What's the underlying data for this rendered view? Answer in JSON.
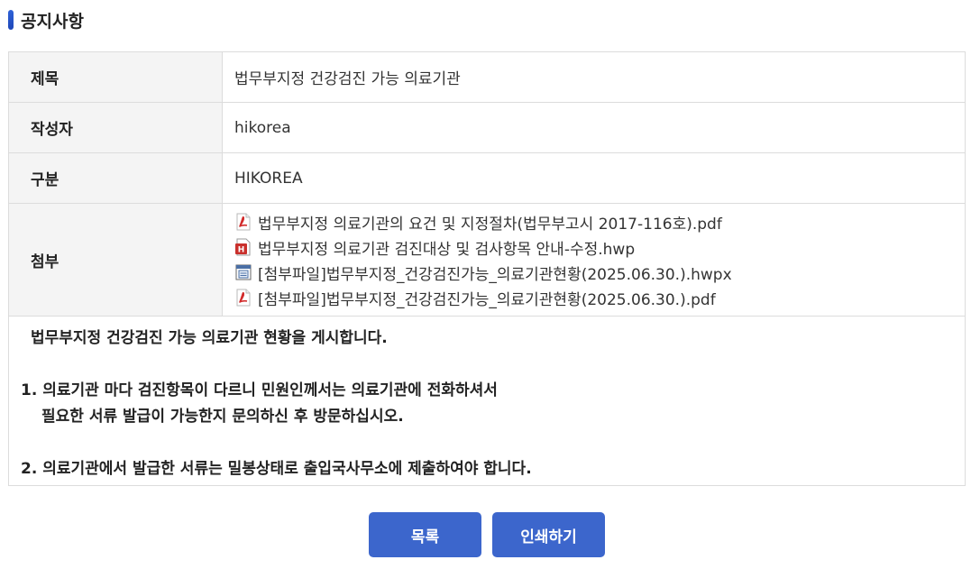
{
  "header": {
    "title": "공지사항"
  },
  "details": {
    "title_label": "제목",
    "title_value": "법무부지정 건강검진 가능 의료기관",
    "author_label": "작성자",
    "author_value": "hikorea",
    "category_label": "구분",
    "category_value": "HIKOREA",
    "attachments_label": "첨부"
  },
  "attachments": [
    {
      "name": "법무부지정 의료기관의 요건 및 지정절차(법무부고시 2017-116호).pdf",
      "icon": "pdf-file-icon"
    },
    {
      "name": "법무부지정 의료기관 검진대상 및 검사항목 안내-수정.hwp",
      "icon": "hwp-file-icon"
    },
    {
      "name": "[첨부파일]법무부지정_건강검진가능_의료기관현황(2025.06.30.).hwpx",
      "icon": "hwpx-file-icon"
    },
    {
      "name": "[첨부파일]법무부지정_건강검진가능_의료기관현황(2025.06.30.).pdf",
      "icon": "pdf-file-icon"
    }
  ],
  "content": {
    "line1": "법무부지정 건강검진 가능 의료기관 현황을 게시합니다.",
    "line2": "1. 의료기관 마다 검진항목이 다르니 민원인께서는 의료기관에 전화하셔서",
    "line3": "필요한 서류 발급이 가능한지 문의하신 후 방문하십시오.",
    "line4": "2. 의료기관에서 발급한 서류는 밀봉상태로 출입국사무소에 제출하여야 합니다."
  },
  "buttons": {
    "list_label": "목록",
    "print_label": "인쇄하기"
  },
  "colors": {
    "accent": "#3c66cc",
    "header_cell_bg": "#f4f4f4",
    "border": "#dcdcdc"
  }
}
